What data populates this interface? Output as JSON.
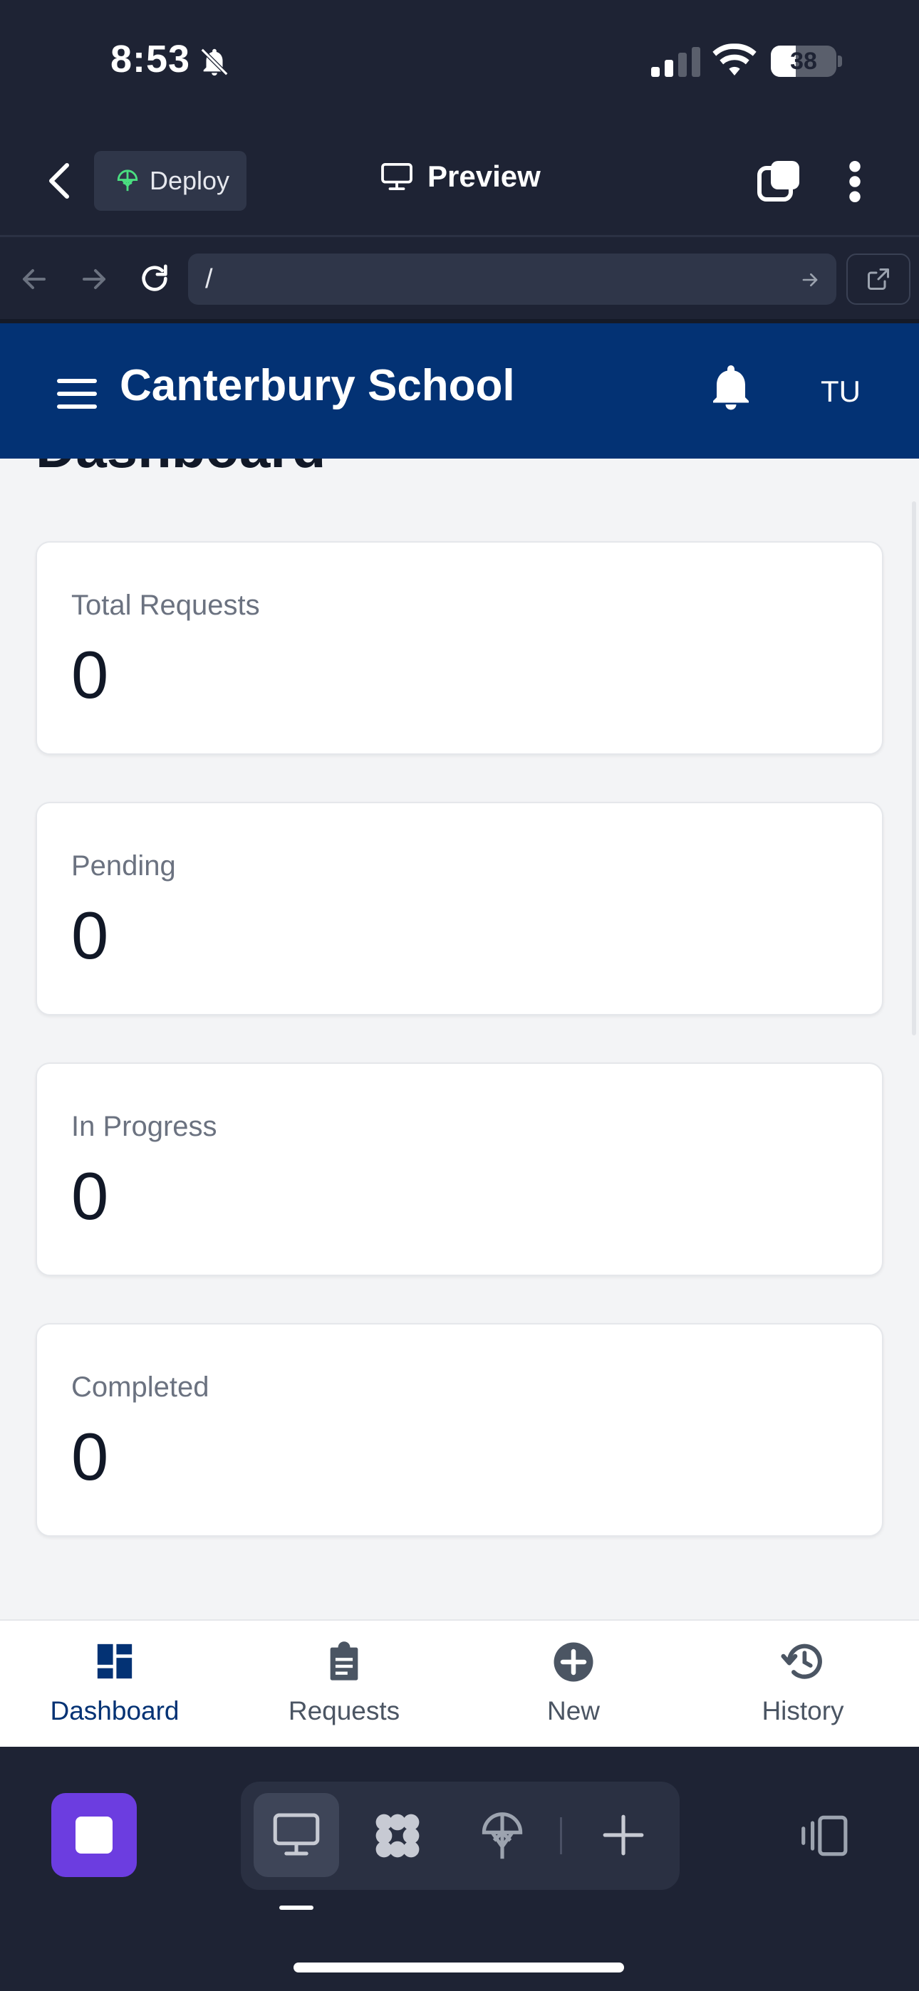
{
  "status_bar": {
    "time": "8:53",
    "battery": "38"
  },
  "replit_header": {
    "deploy_label": "Deploy",
    "preview_label": "Preview"
  },
  "url_bar": {
    "url": "/"
  },
  "app": {
    "title": "Canterbury School",
    "user_initials": "TU",
    "page_title": "Dashboard",
    "stats": [
      {
        "label": "Total Requests",
        "value": "0"
      },
      {
        "label": "Pending",
        "value": "0"
      },
      {
        "label": "In Progress",
        "value": "0"
      },
      {
        "label": "Completed",
        "value": "0"
      }
    ],
    "bottom_nav": [
      {
        "label": "Dashboard",
        "icon": "dashboard-icon",
        "active": true
      },
      {
        "label": "Requests",
        "icon": "clipboard-icon",
        "active": false
      },
      {
        "label": "New",
        "icon": "plus-circle-icon",
        "active": false
      },
      {
        "label": "History",
        "icon": "history-icon",
        "active": false
      }
    ]
  },
  "colors": {
    "app_header": "#033274",
    "accent_purple": "#6c3de0",
    "chrome_bg": "#1e2334"
  }
}
